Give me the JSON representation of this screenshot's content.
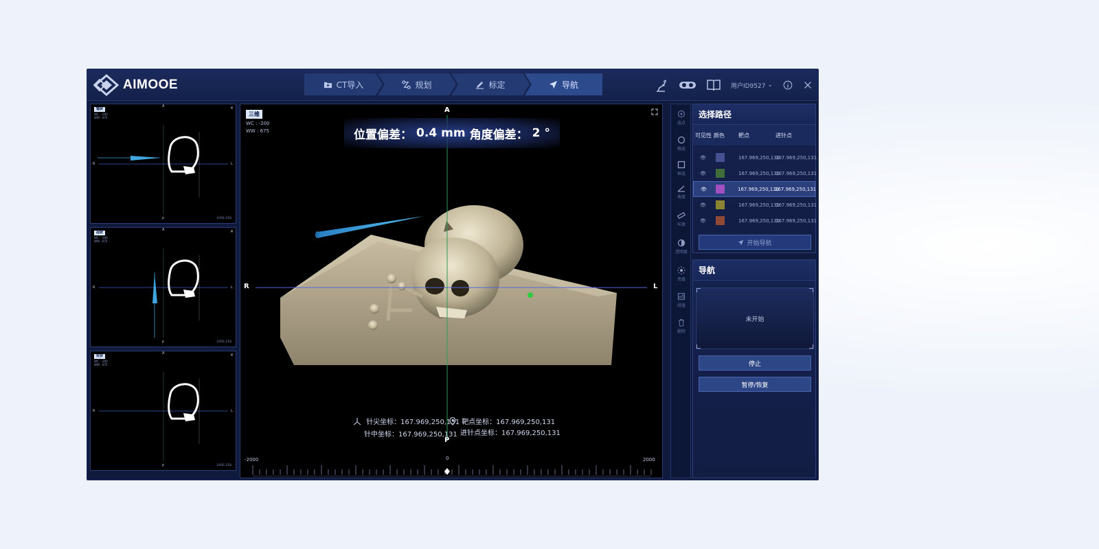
{
  "app": {
    "brand": "AIMOOE"
  },
  "steps": [
    {
      "label": "CT导入",
      "icon": "folder-plus-icon"
    },
    {
      "label": "规划",
      "icon": "route-icon"
    },
    {
      "label": "标定",
      "icon": "pen-icon"
    },
    {
      "label": "导航",
      "icon": "navigation-arrow-icon"
    }
  ],
  "header": {
    "user": "用户ID9527"
  },
  "panes": [
    {
      "tag": "轴状",
      "wc": "WC : -200",
      "ww": "WW : 675",
      "top": "A",
      "bottom": "P",
      "left": "R",
      "right": "L",
      "corner": "1/456 1/56"
    },
    {
      "tag": "冠状",
      "wc": "WC : -200",
      "ww": "WW : 675",
      "top": "A",
      "bottom": "P",
      "left": "R",
      "right": "L",
      "corner": "1/456 1/56"
    },
    {
      "tag": "矢状",
      "wc": "WC : -200",
      "ww": "WW : 675",
      "top": "A",
      "bottom": "P",
      "left": "R",
      "right": "L",
      "corner": "1/456 1/56"
    }
  ],
  "viewport": {
    "tag": "三维",
    "wc": "WC : -200",
    "ww": "WW : 675",
    "deviation": {
      "pos_label": "位置偏差：",
      "pos_value": "0.4",
      "pos_unit": "mm",
      "ang_label": "角度偏差：",
      "ang_value": "2",
      "ang_unit": "°"
    },
    "axes": {
      "top": "A",
      "bottom": "P",
      "left": "R",
      "right": "L"
    },
    "needle_tip": "针尖坐标：167.969,250,131",
    "needle_mid": "针中坐标：167.969,250,131",
    "target": "靶点坐标：167.969,250,131",
    "entry": "进针点坐标：167.969,250,131",
    "scale": {
      "min": "-2000",
      "zero": "0",
      "max": "2000"
    }
  },
  "tools": [
    {
      "label": "选点",
      "icon": "select-point-icon"
    },
    {
      "label": "椭选",
      "icon": "ellipse-select-icon"
    },
    {
      "label": "框选",
      "icon": "rect-select-icon"
    },
    {
      "label": "角度",
      "icon": "angle-icon"
    },
    {
      "label": "长度",
      "icon": "ruler-icon"
    },
    {
      "label": "透明度",
      "icon": "opacity-icon"
    },
    {
      "label": "亮度",
      "icon": "brightness-icon"
    },
    {
      "label": "阈值",
      "icon": "threshold-icon"
    },
    {
      "label": "删除",
      "icon": "trash-icon"
    }
  ],
  "path_panel": {
    "title": "选择路径",
    "columns": [
      "可见性",
      "颜色",
      "靶点",
      "进针点"
    ],
    "rows": [
      {
        "color": "#44508f",
        "target": "167.969,250,131",
        "entry": "167.969,250,131"
      },
      {
        "color": "#3f6e3a",
        "target": "167.969,250,131",
        "entry": "167.969,250,131"
      },
      {
        "color": "#a24fbf",
        "target": "167.969,250,131",
        "entry": "167.969,250,131"
      },
      {
        "color": "#8a8432",
        "target": "167.969,250,131",
        "entry": "167.969,250,131"
      },
      {
        "color": "#8f4a36",
        "target": "167.969,250,131",
        "entry": "167.969,250,131"
      }
    ],
    "start_button": "开始导航"
  },
  "nav_panel": {
    "title": "导航",
    "status": "未开始",
    "stop_button": "停止",
    "pause_button": "暂停/恢复"
  },
  "colors": {
    "accent": "#2d4786",
    "background": "#0f1a3c",
    "needle": "#3fa6e0"
  }
}
